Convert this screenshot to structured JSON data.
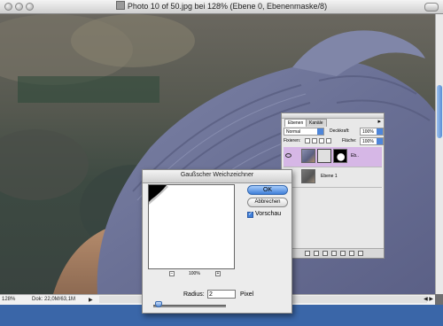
{
  "document": {
    "title": "Photo 10 of 50.jpg bei 128% (Ebene 0, Ebenenmaske/8)",
    "zoom": "128%",
    "doc_size": "Dok: 22,0M/63,1M",
    "status_arrow": "▶",
    "scroll_arrows": "◀ ▶"
  },
  "layers_panel": {
    "tabs": [
      "Ebenen",
      "Kanäle"
    ],
    "blend_mode": "Normal",
    "opacity_label": "Deckkraft:",
    "opacity_value": "100%",
    "lock_label": "Fixieren:",
    "fill_label": "Fläche:",
    "fill_value": "100%",
    "layers": [
      {
        "name": "Eb..",
        "selected": true
      },
      {
        "name": "Ebene 1",
        "selected": false
      }
    ],
    "menu_arrow": "▸"
  },
  "gaussian_blur": {
    "title": "Gaußscher Weichzeichner",
    "ok_label": "OK",
    "cancel_label": "Abbrechen",
    "preview_label": "Vorschau",
    "preview_checked": true,
    "zoom_percent": "100%",
    "zoom_minus": "−",
    "zoom_plus": "+",
    "radius_label": "Radius:",
    "radius_value": "2",
    "radius_unit": "Pixel"
  },
  "colors": {
    "desktop": "#3a66a8",
    "accent_blue": "#3f7fd8",
    "selected_layer": "#d6b7e6"
  }
}
